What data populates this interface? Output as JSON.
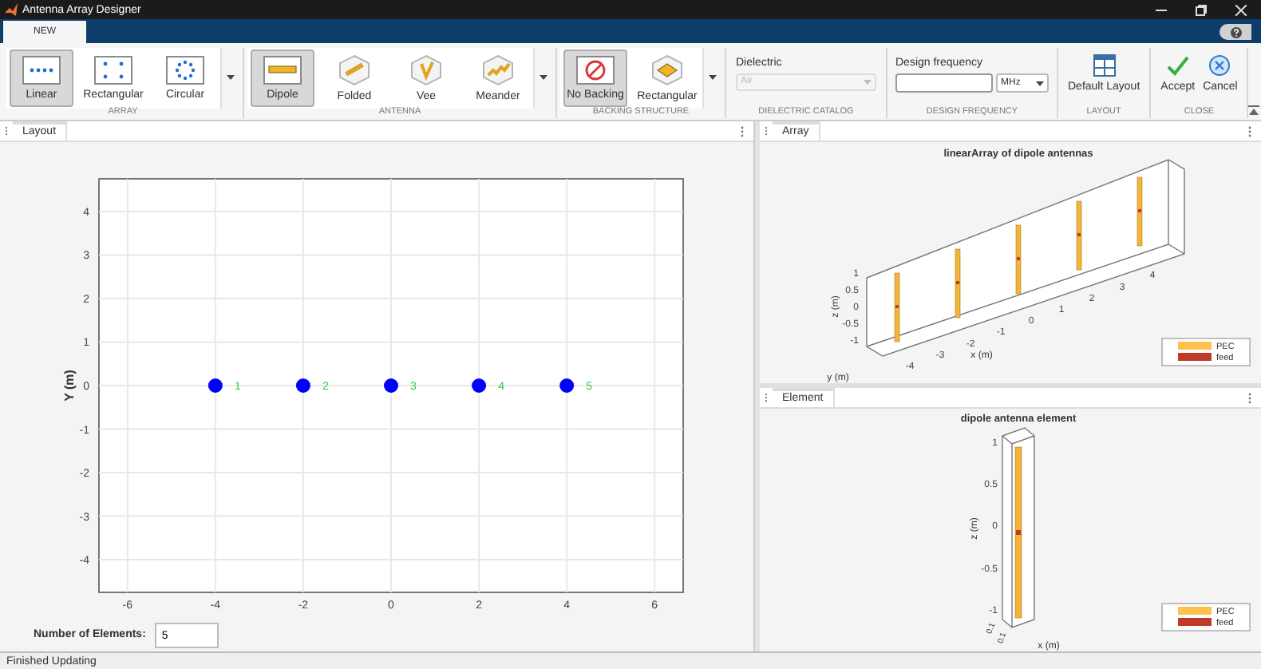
{
  "window": {
    "title": "Antenna Array Designer"
  },
  "tabs": [
    {
      "label": "NEW",
      "selected": true
    }
  ],
  "toolstrip": {
    "sections": [
      {
        "label": "ARRAY",
        "kind": "gallery",
        "items": [
          {
            "label": "Linear",
            "kind": "linear",
            "selected": true
          },
          {
            "label": "Rectangular",
            "kind": "rectangular",
            "selected": false
          },
          {
            "label": "Circular",
            "kind": "circular",
            "selected": false
          }
        ]
      },
      {
        "label": "ANTENNA",
        "kind": "gallery",
        "items": [
          {
            "label": "Dipole",
            "kind": "dipole",
            "selected": true
          },
          {
            "label": "Folded",
            "kind": "folded",
            "selected": false
          },
          {
            "label": "Vee",
            "kind": "vee",
            "selected": false
          },
          {
            "label": "Meander",
            "kind": "meander",
            "selected": false
          }
        ]
      },
      {
        "label": "BACKING STRUCTURE",
        "kind": "gallery",
        "items": [
          {
            "label": "No Backing",
            "kind": "none",
            "selected": true
          },
          {
            "label": "Rectangular",
            "kind": "reflector",
            "selected": false
          }
        ]
      },
      {
        "label": "DIELECTRIC CATALOG",
        "kind": "dropdown",
        "field_label": "Dielectric",
        "value": "Air",
        "disabled": true
      },
      {
        "label": "DESIGN FREQUENCY",
        "kind": "frequency",
        "field_label": "Design frequency",
        "unit": "MHz"
      },
      {
        "label": "LAYOUT",
        "kind": "buttons",
        "items": [
          {
            "label": "Default Layout",
            "kind": "layout"
          }
        ]
      },
      {
        "label": "CLOSE",
        "kind": "buttons",
        "items": [
          {
            "label": "Accept",
            "kind": "accept"
          },
          {
            "label": "Cancel",
            "kind": "cancel"
          }
        ]
      }
    ]
  },
  "layout_panel": {
    "tab": "Layout",
    "chart_data": {
      "type": "scatter",
      "ylabel": "Y (m)",
      "x": [
        -4,
        -2,
        0,
        2,
        4
      ],
      "values": [
        0,
        0,
        0,
        0,
        0
      ],
      "xlim": [
        -6.65,
        6.65
      ],
      "ylim": [
        -4.75,
        4.75
      ],
      "xticks": [
        -6,
        -4,
        -2,
        0,
        2,
        4,
        6
      ],
      "yticks": [
        -4,
        -3,
        -2,
        -1,
        0,
        1,
        2,
        3,
        4
      ],
      "grid": true,
      "annotations": [
        "1",
        "2",
        "3",
        "4",
        "5"
      ]
    },
    "count_field": {
      "label": "Number of Elements:",
      "value": "5"
    }
  },
  "array_panel": {
    "tab": "Array",
    "plot": {
      "title": "linearArray of dipole antennas",
      "z_label": "z (m)",
      "x_label": "x (m)",
      "y_label": "y (m)",
      "z_ticks": [
        "1",
        "0.5",
        "0",
        "-0.5",
        "-1"
      ],
      "x_ticks": [
        "-4",
        "-3",
        "-2",
        "-1",
        "0",
        "1",
        "2",
        "3",
        "4"
      ],
      "legend": [
        {
          "label": "PEC",
          "color": "#ffc04d"
        },
        {
          "label": "feed",
          "color": "#c0392b"
        }
      ]
    }
  },
  "element_panel": {
    "tab": "Element",
    "plot": {
      "title": "dipole antenna element",
      "z_label": "z (m)",
      "x_label": "x (m)",
      "z_ticks": [
        "1",
        "0.5",
        "0",
        "-0.5",
        "-1"
      ],
      "y_ticks": [
        "0.1",
        "0.1"
      ],
      "legend": [
        {
          "label": "PEC",
          "color": "#ffc04d"
        },
        {
          "label": "feed",
          "color": "#c0392b"
        }
      ]
    }
  },
  "status_bar": {
    "text": "Finished Updating"
  }
}
